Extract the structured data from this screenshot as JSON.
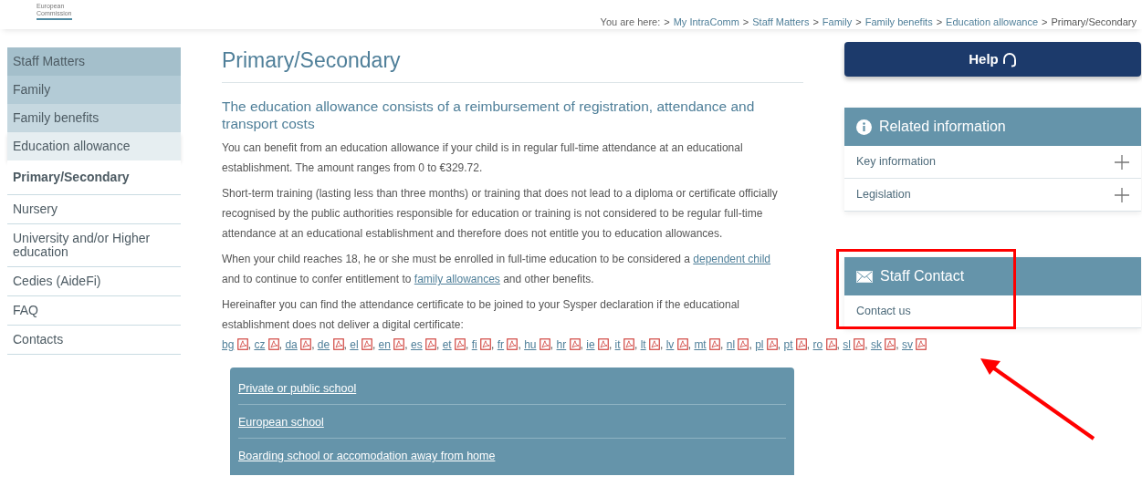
{
  "logo": {
    "lines": [
      "European",
      "Commission"
    ]
  },
  "breadcrumb": {
    "prefix": "You are here:",
    "separator": ">",
    "items": [
      {
        "label": "My IntraComm"
      },
      {
        "label": "Staff Matters"
      },
      {
        "label": "Family"
      },
      {
        "label": "Family benefits"
      },
      {
        "label": "Education allowance"
      },
      {
        "label": "Primary/Secondary"
      }
    ]
  },
  "sidebar": {
    "items": [
      {
        "label": "Staff Matters",
        "kind": "level1",
        "selected": false
      },
      {
        "label": "Family",
        "kind": "level2",
        "selected": false
      },
      {
        "label": "Family benefits",
        "kind": "level3",
        "selected": false
      },
      {
        "label": "Education allowance",
        "kind": "level4",
        "selected": false
      },
      {
        "label": "Primary/Secondary",
        "kind": "child",
        "selected": true
      },
      {
        "label": "Nursery",
        "kind": "child",
        "selected": false
      },
      {
        "label": "University and/or Higher education",
        "kind": "child",
        "selected": false
      },
      {
        "label": "Cedies (AideFi)",
        "kind": "child",
        "selected": false
      },
      {
        "label": "FAQ",
        "kind": "child",
        "selected": false
      },
      {
        "label": "Contacts",
        "kind": "child",
        "selected": false
      }
    ]
  },
  "main": {
    "title": "Primary/Secondary",
    "subtitle": "The education allowance consists of a reimbursement of registration, attendance and transport costs",
    "paragraphs": [
      [
        {
          "kind": "text",
          "text": "You can benefit from an education allowance if your child is in regular full-time attendance at an educational establishment. The amount ranges from 0 to €329.72."
        }
      ],
      [
        {
          "kind": "text",
          "text": "Short-term training (lasting less than three months) or training that does not lead to a diploma or certificate officially recognised by the public authorities responsible for education or training is not considered to be regular full-time attendance at an educational establishment and therefore does not entitle you to education allowances."
        }
      ],
      [
        {
          "kind": "text",
          "text": "When your child reaches 18, he or she must be enrolled in full-time education to be considered a "
        },
        {
          "kind": "link",
          "text": "dependent child"
        },
        {
          "kind": "text",
          "text": " and to continue to confer entitlement to "
        },
        {
          "kind": "link",
          "text": "family allowances"
        },
        {
          "kind": "text",
          "text": " and other benefits."
        }
      ]
    ],
    "certificates": {
      "intro": "Hereinafter you can find the attendance certificate to be joined to your Sysper declaration if the educational establishment does not deliver a digital certificate:",
      "languages": [
        {
          "code": "bg",
          "separator": ","
        },
        {
          "code": "cz",
          "separator": ","
        },
        {
          "code": "da",
          "separator": ","
        },
        {
          "code": "de",
          "separator": ","
        },
        {
          "code": "el",
          "separator": ","
        },
        {
          "code": "en",
          "separator": ","
        },
        {
          "code": "es",
          "separator": ","
        },
        {
          "code": "et",
          "separator": ","
        },
        {
          "code": "fi",
          "separator": ","
        },
        {
          "code": "fr",
          "separator": ","
        },
        {
          "code": "hu",
          "separator": ","
        },
        {
          "code": "hr",
          "separator": ","
        },
        {
          "code": "ie",
          "separator": ","
        },
        {
          "code": "it",
          "separator": ","
        },
        {
          "code": "lt",
          "separator": ","
        },
        {
          "code": "lv",
          "separator": ","
        },
        {
          "code": "mt",
          "separator": ","
        },
        {
          "code": "nl",
          "separator": ","
        },
        {
          "code": "pl",
          "separator": ","
        },
        {
          "code": "pt",
          "separator": ","
        },
        {
          "code": "ro",
          "separator": ","
        },
        {
          "code": "sl",
          "separator": ","
        },
        {
          "code": "sk",
          "separator": ","
        },
        {
          "code": "sv"
        }
      ]
    },
    "school_links": [
      "Private or public school",
      "European school",
      "Boarding school or accomodation away from home"
    ]
  },
  "right": {
    "help": {
      "label": "Help"
    },
    "panels": [
      {
        "title": "Related information",
        "kind": "info",
        "highlighted": false,
        "items": [
          {
            "label": "Key information",
            "expandable": true
          },
          {
            "label": "Legislation",
            "expandable": true
          }
        ]
      },
      {
        "title": "Staff Contact",
        "kind": "mail",
        "highlighted": true,
        "items": [
          {
            "label": "Contact us",
            "expandable": false
          }
        ]
      }
    ]
  },
  "annotation": {
    "arrow": true
  }
}
